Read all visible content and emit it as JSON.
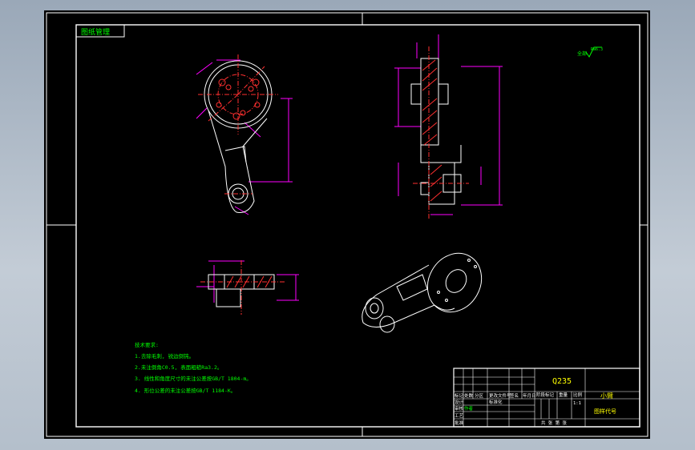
{
  "drawing": {
    "corner_stamp": "图纸管理",
    "roughness_note": "全部",
    "roughness_value": "Ra6.3",
    "tech_req": {
      "heading": "技术要求:",
      "items": [
        "1.去除毛刺, 锐边倒钝。",
        "2.未注倒角C0.5, 表面粗糙Ra3.2。",
        "3. 线性和角度尺寸的未注公差按GB/T 1804-m。",
        "4. 形位公差的未注公差按GB/T 1184-K。"
      ]
    },
    "title_block": {
      "material": "Q235",
      "part_name": "小臂",
      "drawing_code": "图样代号",
      "labels": [
        "标记",
        "处数",
        "分区",
        "更改文件号",
        "签名",
        "年月日",
        "设计",
        "标准化",
        "审核",
        "工艺",
        "批准",
        "阶段标记",
        "重量",
        "比例",
        "共 张 第 张"
      ],
      "designer": "作者",
      "scale": "1:1"
    }
  },
  "colors": {
    "outline": "#ffffff",
    "dimension": "#ff00ff",
    "centerline": "#ff3030",
    "hatch": "#ff3030",
    "note_text": "#00ff00",
    "title_text": "#ffff00"
  }
}
